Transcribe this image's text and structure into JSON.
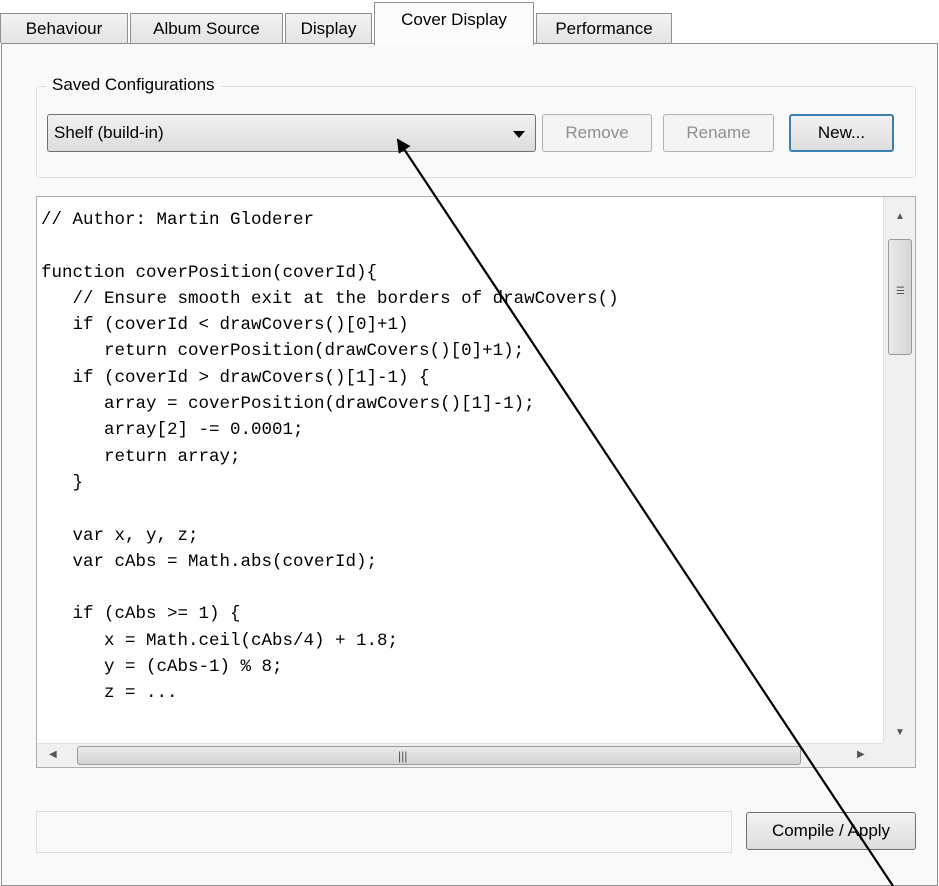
{
  "tabs": [
    {
      "label": "Behaviour"
    },
    {
      "label": "Album Source"
    },
    {
      "label": "Display"
    },
    {
      "label": "Cover Display",
      "active": true
    },
    {
      "label": "Performance"
    }
  ],
  "saved_configurations": {
    "title": "Saved Configurations",
    "selected": "Shelf (build-in)",
    "remove_label": "Remove",
    "rename_label": "Rename",
    "new_label": "New..."
  },
  "editor": {
    "code": "// Author: Martin Gloderer\n\nfunction coverPosition(coverId){\n   // Ensure smooth exit at the borders of drawCovers()\n   if (coverId < drawCovers()[0]+1)\n      return coverPosition(drawCovers()[0]+1);\n   if (coverId > drawCovers()[1]-1) {\n      array = coverPosition(drawCovers()[1]-1);\n      array[2] -= 0.0001;\n      return array;\n   }\n\n   var x, y, z;\n   var cAbs = Math.abs(coverId);\n\n   if (cAbs >= 1) {\n      x = Math.ceil(cAbs/4) + 1.8;\n      y = (cAbs-1) % 8;\n      z = ..."
  },
  "status_text": "",
  "compile_label": "Compile / Apply",
  "icons": {
    "combo": "chevron-down-icon",
    "scroll_up": "arrow-up-icon",
    "scroll_down": "arrow-down-icon",
    "scroll_left": "arrow-left-icon",
    "scroll_right": "arrow-right-icon",
    "grip": "grip-icon"
  },
  "colors": {
    "panel_bg": "#f9f9f9",
    "border": "#8e8f8f",
    "default_button_border": "#3c7fb1",
    "disabled_text": "#8f8f8f",
    "annotation_line": "#000000"
  }
}
